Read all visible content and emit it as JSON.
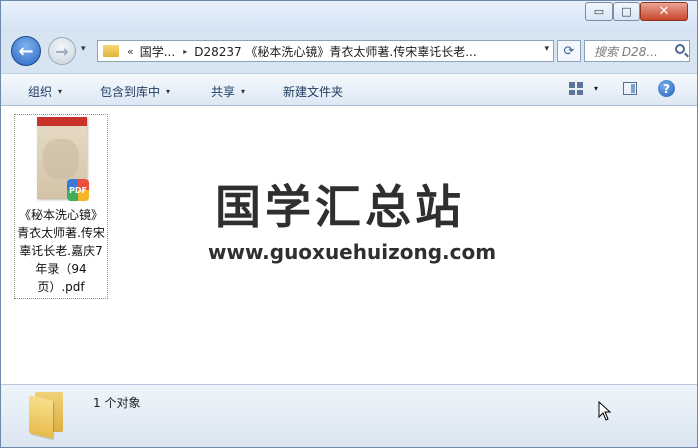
{
  "window": {
    "minimize_glyph": "▭",
    "maximize_glyph": "□",
    "close_glyph": "✕"
  },
  "nav": {
    "back_glyph": "←",
    "forward_glyph": "→",
    "history_glyph": "▾",
    "address": {
      "overflow_chevron": "«",
      "crumb_1": "国学...",
      "separator": "▸",
      "crumb_2": "D28237 《秘本洗心镜》青衣太师著.传宋辜讬长老...",
      "dropdown_glyph": "▾"
    },
    "refresh_glyph": "⟳",
    "search_placeholder": "搜索 D28..."
  },
  "toolbar": {
    "organize": "组织",
    "include_library": "包含到库中",
    "share": "共享",
    "new_folder": "新建文件夹",
    "caret": "▾"
  },
  "files": [
    {
      "name": "《秘本洗心镜》青衣太师著.传宋辜讬长老.嘉庆7年录（94页）.pdf",
      "badge": "PDF"
    }
  ],
  "watermark": {
    "title": "国学汇总站",
    "url": "www.guoxuehuizong.com"
  },
  "details": {
    "count_text": "1 个对象"
  },
  "help": {
    "glyph": "?"
  }
}
